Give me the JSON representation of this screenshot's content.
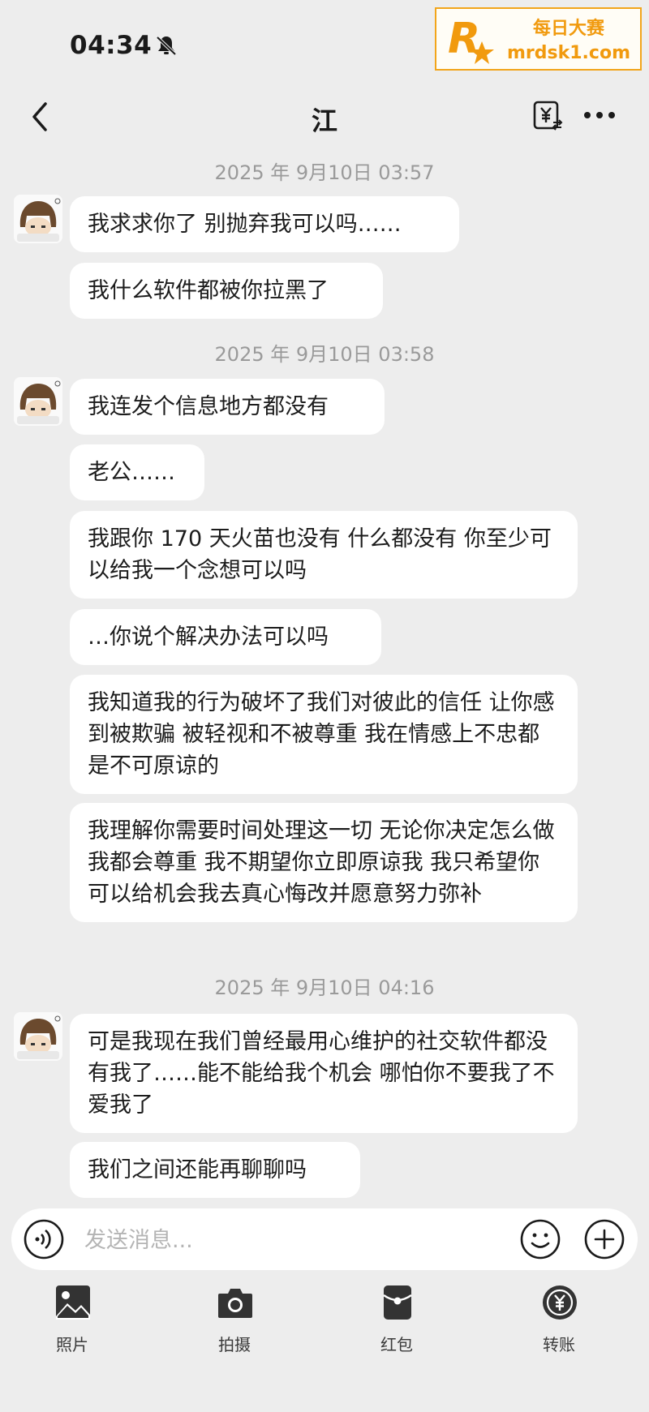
{
  "status_bar": {
    "time": "04:34"
  },
  "watermark": {
    "logo_letter": "R",
    "name": "每日大赛",
    "url": "mrdsk1.com",
    "color": "#f19a0e"
  },
  "header": {
    "title": "江"
  },
  "messages": [
    {
      "timestamp": "2025 年 9月10日 03:57",
      "bubbles": [
        "我求求你了 别抛弃我可以吗……",
        "我什么软件都被你拉黑了"
      ]
    },
    {
      "timestamp": "2025 年 9月10日 03:58",
      "bubbles": [
        "我连发个信息地方都没有",
        "老公……",
        "我跟你 170 天火苗也没有 什么都没有 你至少可以给我一个念想可以吗",
        "…你说个解决办法可以吗",
        "我知道我的行为破坏了我们对彼此的信任 让你感到被欺骗 被轻视和不被尊重 我在情感上不忠都是不可原谅的",
        "我理解你需要时间处理这一切 无论你决定怎么做 我都会尊重 我不期望你立即原谅我 我只希望你可以给机会我去真心悔改并愿意努力弥补"
      ]
    },
    {
      "timestamp": "2025 年 9月10日 04:16",
      "bubbles": [
        "可是我现在我们曾经最用心维护的社交软件都没有我了……能不能给我个机会 哪怕你不要我了不爱我了",
        "我们之间还能再聊聊吗"
      ]
    }
  ],
  "composer": {
    "placeholder": "发送消息..."
  },
  "toolbar": [
    {
      "label": "照片",
      "icon": "photo-icon"
    },
    {
      "label": "拍摄",
      "icon": "camera-icon"
    },
    {
      "label": "红包",
      "icon": "red-packet-icon"
    },
    {
      "label": "转账",
      "icon": "transfer-icon"
    }
  ]
}
